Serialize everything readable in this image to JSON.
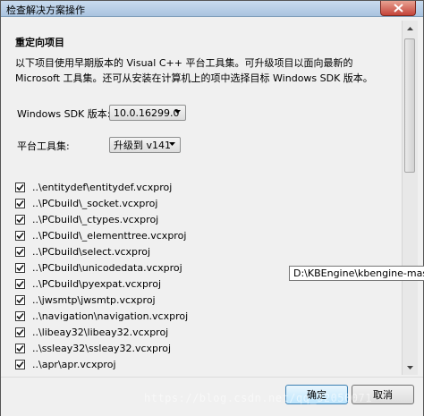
{
  "window": {
    "title": "检查解决方案操作"
  },
  "main": {
    "heading": "重定向项目",
    "description": "以下项目使用早期版本的 Visual C++ 平台工具集。可升级项目以面向最新的 Microsoft 工具集。还可从安装在计算机上的项中选择目标 Windows SDK 版本。",
    "sdk_label": "Windows SDK 版本:",
    "sdk_value": "10.0.16299.0",
    "toolset_label": "平台工具集:",
    "toolset_value": "升级到 v141",
    "projects": [
      {
        "label": "..\\entitydef\\entitydef.vcxproj",
        "checked": true
      },
      {
        "label": "..\\PCbuild\\_socket.vcxproj",
        "checked": true
      },
      {
        "label": "..\\PCbuild\\_ctypes.vcxproj",
        "checked": true
      },
      {
        "label": "..\\PCbuild\\_elementtree.vcxproj",
        "checked": true
      },
      {
        "label": "..\\PCbuild\\select.vcxproj",
        "checked": true
      },
      {
        "label": "..\\PCbuild\\unicodedata.vcxproj",
        "checked": true
      },
      {
        "label": "..\\PCbuild\\pyexpat.vcxproj",
        "checked": true
      },
      {
        "label": "..\\jwsmtp\\jwsmtp.vcxproj",
        "checked": true
      },
      {
        "label": "..\\navigation\\navigation.vcxproj",
        "checked": true
      },
      {
        "label": "..\\libeay32\\libeay32.vcxproj",
        "checked": true
      },
      {
        "label": "..\\ssleay32\\ssleay32.vcxproj",
        "checked": true
      },
      {
        "label": "..\\apr\\apr.vcxproj",
        "checked": true
      }
    ]
  },
  "tooltip": {
    "text": "D:\\KBEngine\\kbengine-maste"
  },
  "footer": {
    "ok_label": "确定",
    "cancel_label": "取消"
  },
  "watermark": {
    "text": "https://blog.csdn.net/qq_32050071"
  },
  "colors": {
    "accent": "#3c7fb1",
    "window_bg": "#f0f0f0",
    "close_red": "#c4443a"
  }
}
